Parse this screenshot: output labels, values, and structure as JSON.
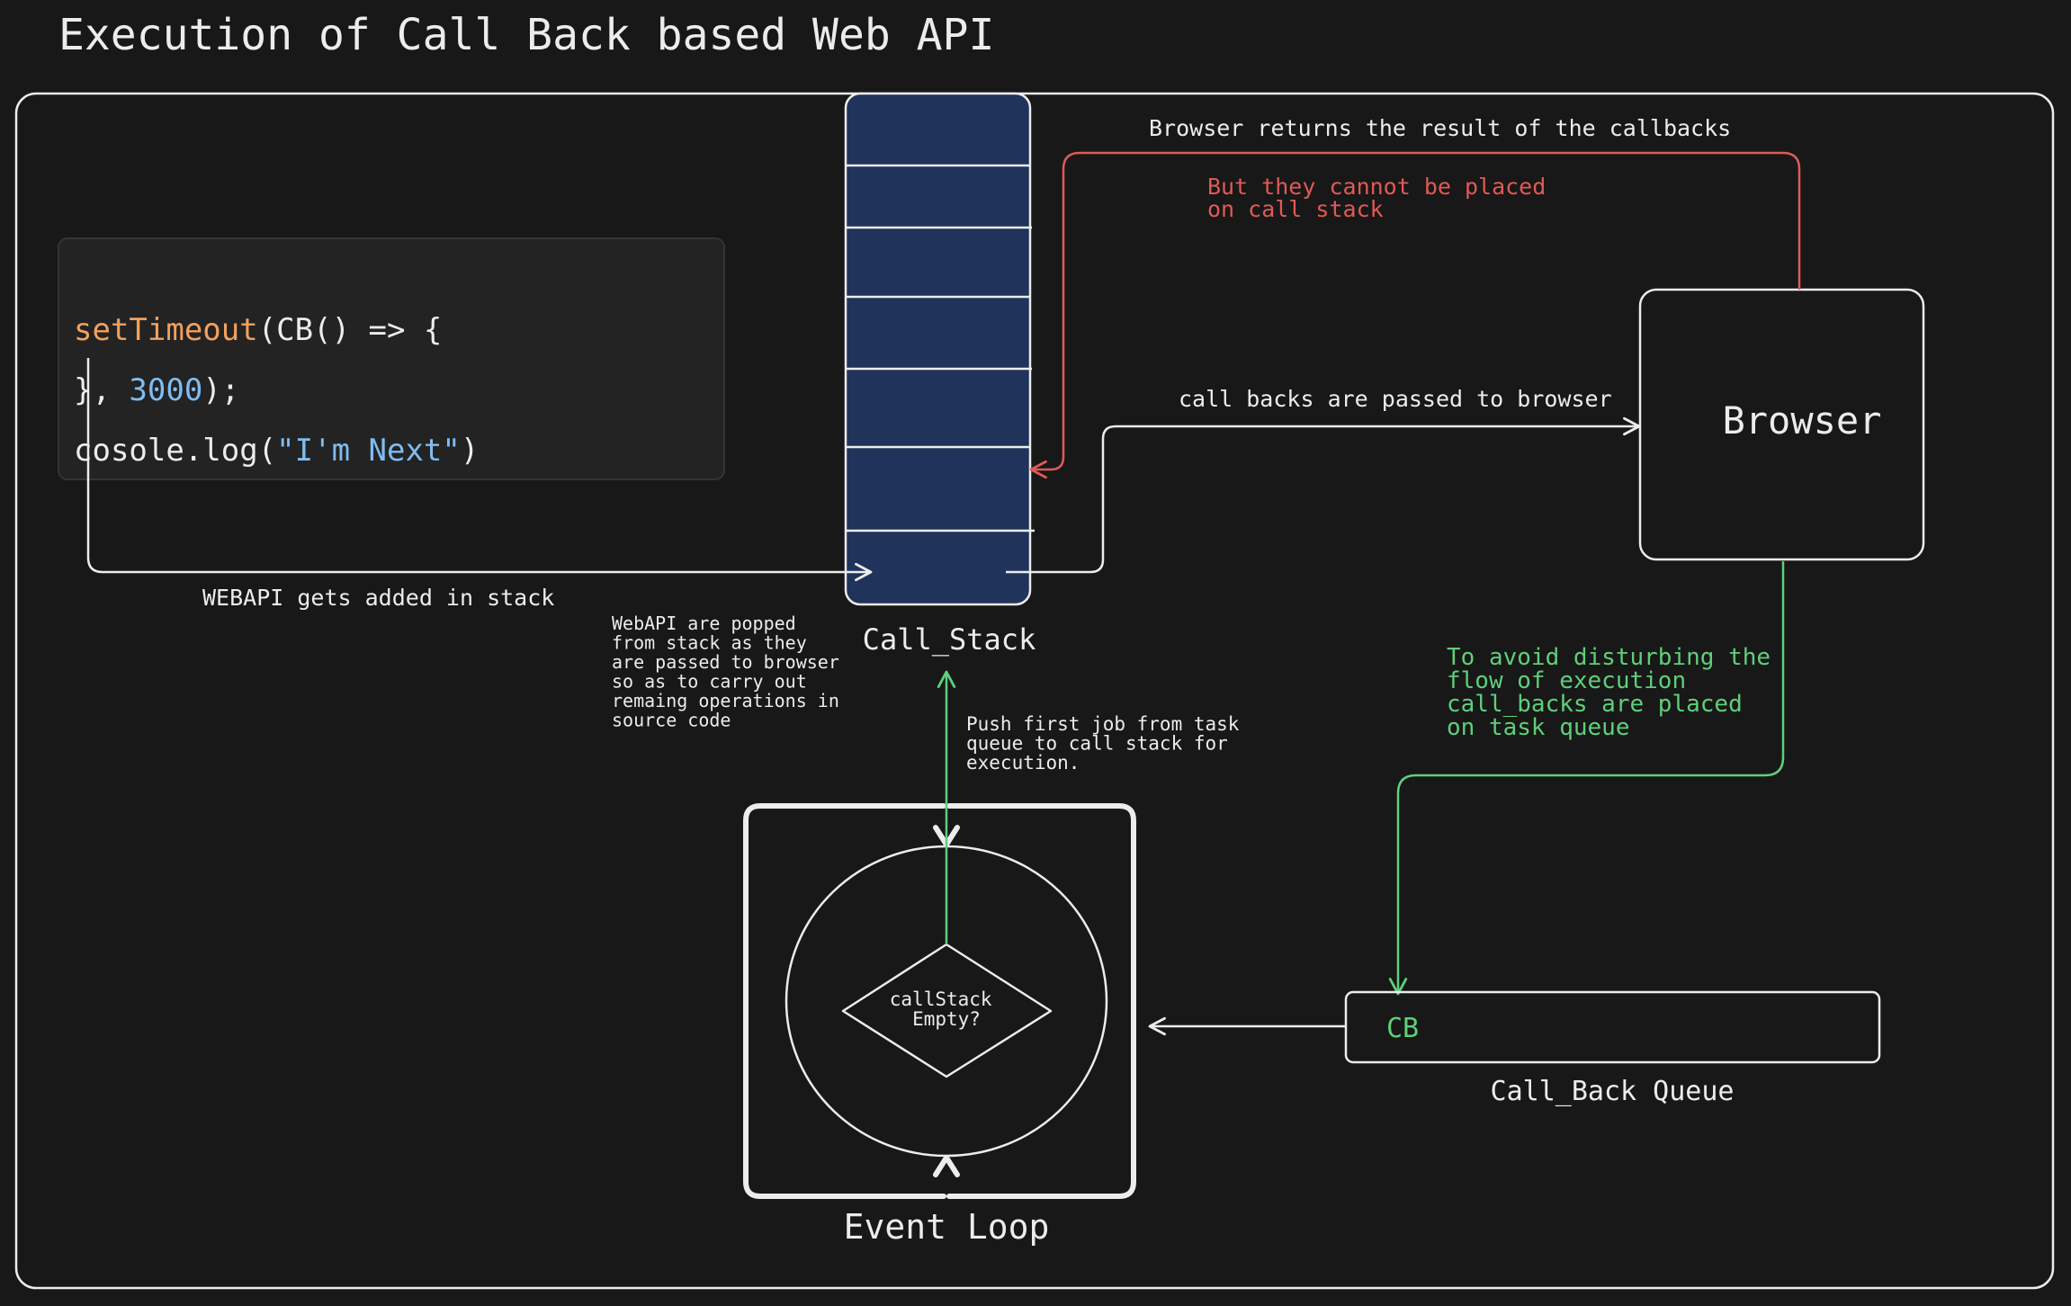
{
  "title": "Execution of Call Back based Web API",
  "code": {
    "line1": {
      "fn": "setTimeout",
      "rest": "(CB() => {"
    },
    "line2": {
      "open": "}, ",
      "num": "3000",
      "close": ");"
    },
    "line3": {
      "prefix": "cosole.log(",
      "str": "\"I'm Next\"",
      "suffix": ")"
    }
  },
  "call_stack": {
    "label": "Call_Stack"
  },
  "browser": {
    "label": "Browser"
  },
  "event_loop": {
    "label": "Event Loop",
    "decision": [
      "callStack",
      "Empty?"
    ]
  },
  "callback_queue": {
    "label": "Call_Back Queue",
    "item": "CB"
  },
  "annotations": {
    "webapi_added": "WEBAPI gets added in stack",
    "webapi_popped": [
      "WebAPI are popped",
      "from stack as they",
      "are passed to browser",
      "so as to carry out",
      "remaing operations in",
      "source code"
    ],
    "callbacks_passed": "call backs are passed to browser",
    "browser_returns": "Browser returns the result of the callbacks",
    "cannot_place": [
      "But they cannot be placed",
      "on call stack"
    ],
    "avoid_disturbing": [
      "To avoid disturbing the",
      "flow of execution",
      "call_backs are placed",
      "on task queue"
    ],
    "push_first": [
      "Push first job from task",
      "queue to call stack for",
      "execution."
    ]
  },
  "colors": {
    "background": "#181818",
    "stroke": "#ececec",
    "stack_fill": "#20335a",
    "code_panel": "#232323",
    "orange": "#f2a15c",
    "blue": "#7fbcf1",
    "red": "#e05a55",
    "green": "#5fcf7a"
  }
}
